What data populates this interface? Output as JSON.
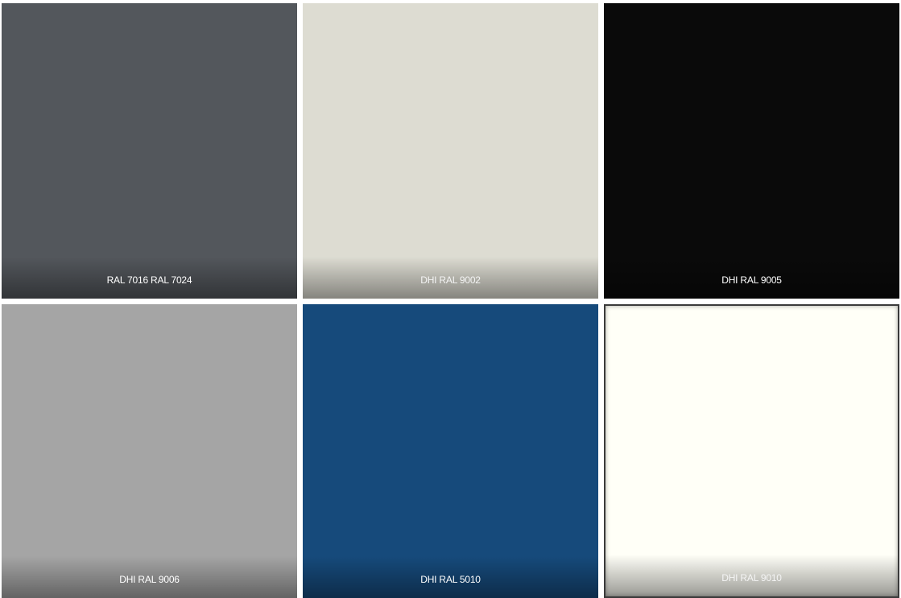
{
  "swatches": [
    {
      "label": "RAL 7016 RAL 7024",
      "color": "#53575c"
    },
    {
      "label": "DHI RAL 9002",
      "color": "#dddcd2"
    },
    {
      "label": "DHI RAL 9005",
      "color": "#0a0a0a"
    },
    {
      "label": "DHI RAL 9006",
      "color": "#a5a5a5"
    },
    {
      "label": "DHI RAL 5010",
      "color": "#164a7b"
    },
    {
      "label": "DHI RAL 9010",
      "color": "#fffff7"
    }
  ]
}
